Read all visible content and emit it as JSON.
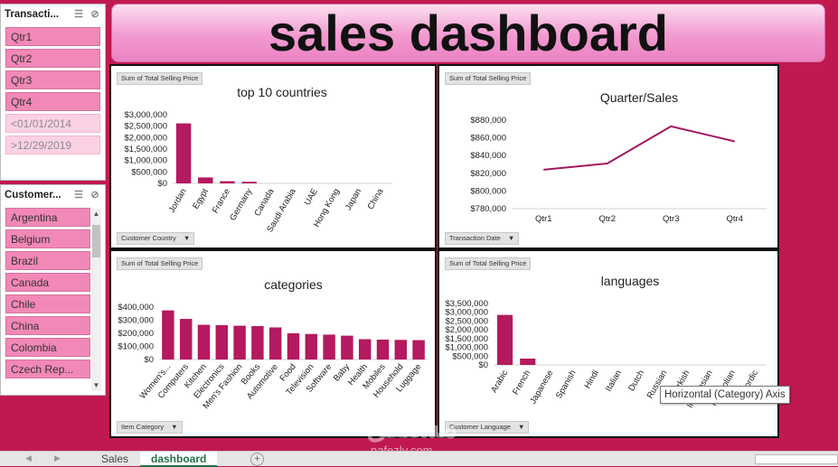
{
  "title": "sales dashboard",
  "slicers": {
    "transaction": {
      "title": "Transacti...",
      "items": [
        {
          "label": "Qtr1",
          "enabled": true
        },
        {
          "label": "Qtr2",
          "enabled": true
        },
        {
          "label": "Qtr3",
          "enabled": true
        },
        {
          "label": "Qtr4",
          "enabled": true
        },
        {
          "label": "<01/01/2014",
          "enabled": false
        },
        {
          "label": ">12/29/2019",
          "enabled": false
        }
      ]
    },
    "customer": {
      "title": "Customer...",
      "items": [
        "Argentina",
        "Belgium",
        "Brazil",
        "Canada",
        "Chile",
        "China",
        "Colombia",
        "Czech Rep..."
      ]
    }
  },
  "tooltip": "Horizontal (Category) Axis",
  "tabs": {
    "sales": "Sales",
    "dashboard": "dashboard",
    "add": "+"
  },
  "watermark": {
    "main": "مستقل",
    "sub": "nafezly.com"
  },
  "colors": {
    "bar": "#b5195f",
    "line": "#a31a62",
    "background": "#c0194f",
    "accent": "#f288b8"
  },
  "chart_data": [
    {
      "type": "bar",
      "field_button": "Sum of Total Selling Price",
      "title": "top 10 countries",
      "categories": [
        "Jordan",
        "Egypt",
        "France",
        "Germany",
        "Canada",
        "Saudi Arabia",
        "UAE",
        "Hong Kong",
        "Japan",
        "China"
      ],
      "values": [
        2620000,
        260000,
        95000,
        70000,
        0,
        0,
        0,
        0,
        0,
        0
      ],
      "ylim": [
        0,
        3000000
      ],
      "yticks": [
        "$3,000,000",
        "$2,500,000",
        "$2,000,000",
        "$1,500,000",
        "$1,000,000",
        "$500,000",
        "$0"
      ],
      "axis_button": "Customer Country"
    },
    {
      "type": "line",
      "field_button": "Sum of Total Selling Price",
      "title": "Quarter/Sales",
      "categories": [
        "Qtr1",
        "Qtr2",
        "Qtr3",
        "Qtr4"
      ],
      "values": [
        824000,
        831000,
        873000,
        856000
      ],
      "ylim": [
        780000,
        880000
      ],
      "yticks": [
        "$880,000",
        "$860,000",
        "$840,000",
        "$820,000",
        "$800,000",
        "$780,000"
      ],
      "axis_button": "Transaction Date"
    },
    {
      "type": "bar",
      "field_button": "Sum of Total Selling Price",
      "title": "categories",
      "categories": [
        "Women's...",
        "Computers",
        "Kitchen",
        "Electronics",
        "Men's Fashion",
        "Books",
        "Automotive",
        "Food",
        "Television",
        "Software",
        "Baby",
        "Health",
        "Mobiles",
        "Household",
        "Luggage"
      ],
      "values": [
        375000,
        310000,
        265000,
        262000,
        258000,
        255000,
        245000,
        200000,
        195000,
        190000,
        182000,
        155000,
        152000,
        150000,
        148000
      ],
      "ylim": [
        0,
        400000
      ],
      "yticks": [
        "$400,000",
        "$300,000",
        "$200,000",
        "$100,000",
        "$0"
      ],
      "axis_button": "Item Category"
    },
    {
      "type": "bar",
      "field_button": "Sum of Total Selling Price",
      "title": "languages",
      "categories": [
        "Arabic",
        "French",
        "Japanese",
        "Spanish",
        "Hindi",
        "Italian",
        "Dutch",
        "Russian",
        "Turkish",
        "Indonesian",
        "Mongolian",
        "Nordic"
      ],
      "values": [
        2850000,
        360000,
        0,
        0,
        0,
        0,
        0,
        0,
        0,
        0,
        0,
        0
      ],
      "ylim": [
        0,
        3500000
      ],
      "yticks": [
        "$3,500,000",
        "$3,000,000",
        "$2,500,000",
        "$2,000,000",
        "$1,500,000",
        "$1,000,000",
        "$500,000",
        "$0"
      ],
      "axis_button": "Customer Language"
    }
  ]
}
